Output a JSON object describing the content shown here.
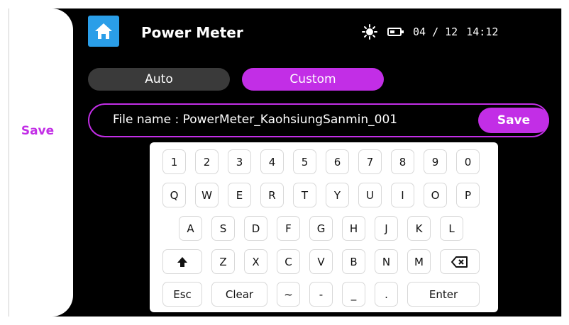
{
  "app": {
    "title": "Power Meter"
  },
  "sidebar": {
    "save_label": "Save"
  },
  "status": {
    "date": "04 / 12",
    "time": "14:12"
  },
  "modes": {
    "auto": "Auto",
    "custom": "Custom",
    "selected": "Custom"
  },
  "file": {
    "label": "File name : PowerMeter_KaohsiungSanmin_001",
    "save_label": "Save"
  },
  "keyboard": {
    "row1": [
      "1",
      "2",
      "3",
      "4",
      "5",
      "6",
      "7",
      "8",
      "9",
      "0"
    ],
    "row2": [
      "Q",
      "W",
      "E",
      "R",
      "T",
      "Y",
      "U",
      "I",
      "O",
      "P"
    ],
    "row3": [
      "A",
      "S",
      "D",
      "F",
      "G",
      "H",
      "J",
      "K",
      "L"
    ],
    "row4": [
      "Z",
      "X",
      "C",
      "V",
      "B",
      "N",
      "M"
    ],
    "row5": {
      "esc": "Esc",
      "clear": "Clear",
      "tilde": "~",
      "dash": "-",
      "underscore": "_",
      "dot": ".",
      "enter": "Enter"
    }
  },
  "colors": {
    "accent": "#c22ee6",
    "home_icon_bg": "#2a9ee8",
    "inactive_mode": "#3a3a3a",
    "screen_bg": "#000000"
  },
  "icons": [
    "home-icon",
    "brightness-icon",
    "battery-icon",
    "shift-icon",
    "backspace-icon"
  ]
}
